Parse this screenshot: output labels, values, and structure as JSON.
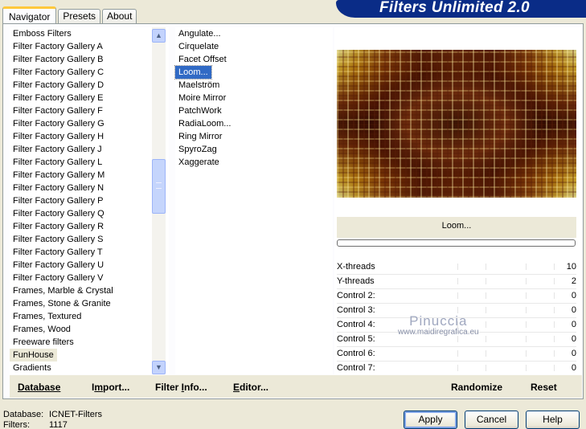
{
  "app": {
    "title": "Filters Unlimited 2.0"
  },
  "tabs": [
    {
      "label": "Navigator",
      "active": true
    },
    {
      "label": "Presets",
      "active": false
    },
    {
      "label": "About",
      "active": false
    }
  ],
  "categories": {
    "items": [
      "Emboss Filters",
      "Filter Factory Gallery A",
      "Filter Factory Gallery B",
      "Filter Factory Gallery C",
      "Filter Factory Gallery D",
      "Filter Factory Gallery E",
      "Filter Factory Gallery F",
      "Filter Factory Gallery G",
      "Filter Factory Gallery H",
      "Filter Factory Gallery J",
      "Filter Factory Gallery L",
      "Filter Factory Gallery M",
      "Filter Factory Gallery N",
      "Filter Factory Gallery P",
      "Filter Factory Gallery Q",
      "Filter Factory Gallery R",
      "Filter Factory Gallery S",
      "Filter Factory Gallery T",
      "Filter Factory Gallery U",
      "Filter Factory Gallery V",
      "Frames, Marble & Crystal",
      "Frames, Stone & Granite",
      "Frames, Textured",
      "Frames, Wood",
      "Freeware filters",
      "FunHouse",
      "Gradients"
    ],
    "selected": "FunHouse"
  },
  "filters": {
    "items": [
      "Angulate...",
      "Cirquelate",
      "Facet Offset",
      "Loom...",
      "Maelström",
      "Moire Mirror",
      "PatchWork",
      "RadiaLoom...",
      "Ring Mirror",
      "SpyroZag",
      "Xaggerate"
    ],
    "selected": "Loom..."
  },
  "preview": {
    "filter_name": "Loom...",
    "progress": 0
  },
  "params": [
    {
      "label": "X-threads",
      "value": "10"
    },
    {
      "label": "Y-threads",
      "value": "2"
    },
    {
      "label": "Control 2:",
      "value": "0"
    },
    {
      "label": "Control 3:",
      "value": "0"
    },
    {
      "label": "Control 4:",
      "value": "0"
    },
    {
      "label": "Control 5:",
      "value": "0"
    },
    {
      "label": "Control 6:",
      "value": "0"
    },
    {
      "label": "Control 7:",
      "value": "0"
    }
  ],
  "watermark": {
    "line1": "Pinuccia",
    "line2": "www.maidiregrafica.eu"
  },
  "toolbar": {
    "database_label": "Database",
    "import_label": "Import...",
    "filter_info_label": "Filter Info...",
    "editor_label": "Editor...",
    "randomize_label": "Randomize",
    "reset_label": "Reset"
  },
  "status": {
    "database_key": "Database:",
    "database_value": "ICNET-Filters",
    "filters_key": "Filters:",
    "filters_value": "1117"
  },
  "buttons": {
    "apply": "Apply",
    "cancel": "Cancel",
    "help": "Help"
  },
  "colors": {
    "banner": "#0a2c87",
    "selection": "#316ac5",
    "tab_highlight": "#ffc83c",
    "face": "#ece9d8"
  }
}
